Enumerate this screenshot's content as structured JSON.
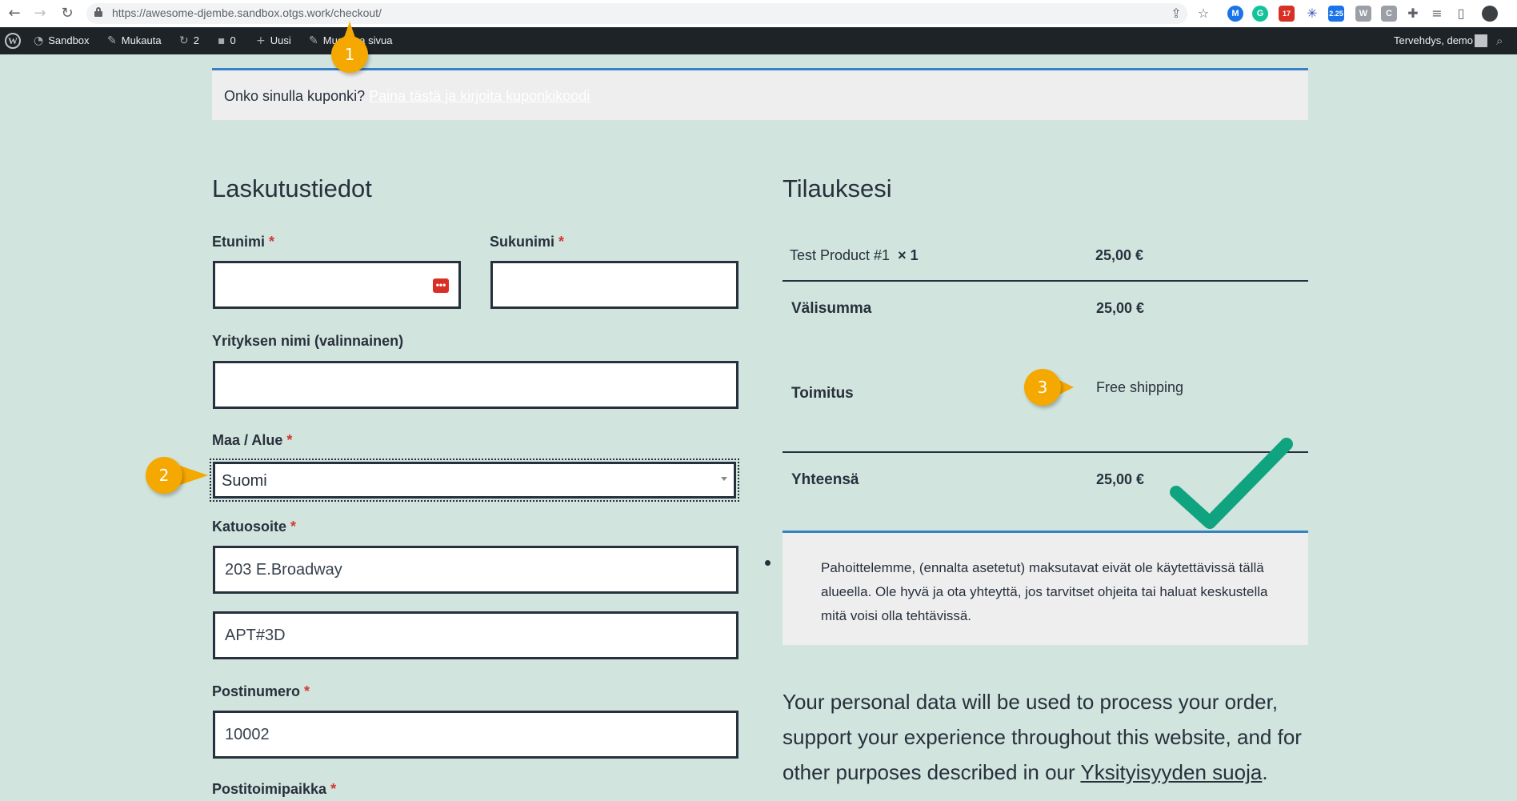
{
  "browser": {
    "url": "https://awesome-djembe.sandbox.otgs.work/checkout/",
    "ext_badges": [
      "17",
      "2.25"
    ]
  },
  "adminbar": {
    "wp_logo": "W",
    "site": "Sandbox",
    "customize": "Mukauta",
    "updates_count": "2",
    "comments_count": "0",
    "new": "Uusi",
    "edit_page": "Muokkaa sivua",
    "greeting": "Tervehdys, demo"
  },
  "coupon": {
    "question": "Onko sinulla kuponki?",
    "link": "Paina tästä ja kirjoita kuponkikoodi"
  },
  "billing": {
    "heading": "Laskutustiedot",
    "first_name_label": "Etunimi",
    "last_name_label": "Sukunimi",
    "company_label": "Yrityksen nimi (valinnainen)",
    "country_label": "Maa / Alue",
    "country_value": "Suomi",
    "street_label": "Katuosoite",
    "street1_value": "203 E.Broadway",
    "street2_value": "APT#3D",
    "postcode_label": "Postinumero",
    "postcode_value": "10002",
    "city_label": "Postitoimipaikka",
    "required_mark": "*"
  },
  "order": {
    "heading": "Tilauksesi",
    "product_name": "Test Product #1",
    "product_qty": "× 1",
    "product_total": "25,00 €",
    "subtotal_label": "Välisumma",
    "subtotal_value": "25,00 €",
    "shipping_label": "Toimitus",
    "shipping_value": "Free shipping",
    "total_label": "Yhteensä",
    "total_value": "25,00 €"
  },
  "payment": {
    "notice": "Pahoittelemme, (ennalta asetetut) maksutavat eivät ole käytettävissä tällä alueella. Ole hyvä ja ota yhteyttä, jos tarvitset ohjeita tai haluat keskustella mitä voisi olla tehtävissä."
  },
  "privacy": {
    "text": "Your personal data will be used to process your order, support your experience throughout this website, and for other purposes described in our",
    "link": "Yksityisyyden suoja",
    "end": "."
  },
  "markers": [
    "1",
    "2",
    "3"
  ],
  "colors": {
    "page_bg": "#d1e4dd",
    "text": "#28303d",
    "notice_border": "#3582c4",
    "required": "#d63638",
    "marker": "#f5a800",
    "checkmark": "#10a37f"
  }
}
